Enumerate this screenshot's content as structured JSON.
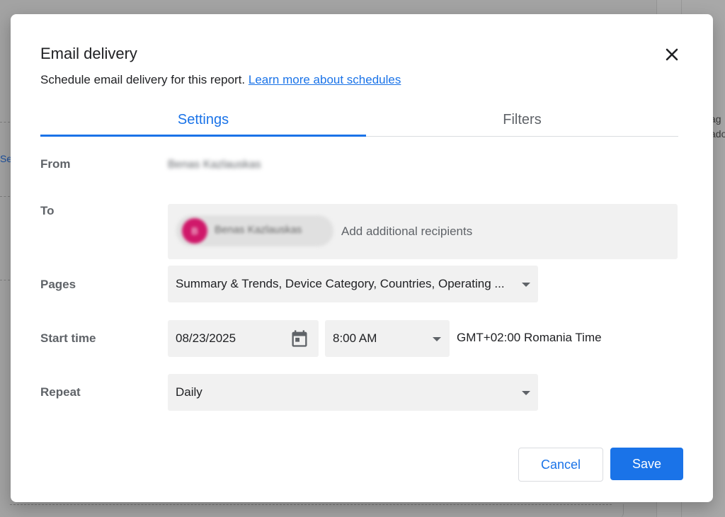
{
  "background": {
    "left_link": "Se",
    "side_text_1": "ag",
    "side_text_2": "ado"
  },
  "dialog": {
    "title": "Email delivery",
    "subtitle": "Schedule email delivery for this report.",
    "learn_more_link": "Learn more about schedules",
    "close_icon": "close-icon"
  },
  "tabs": [
    {
      "label": "Settings",
      "active": true
    },
    {
      "label": "Filters",
      "active": false
    }
  ],
  "form": {
    "from": {
      "label": "From",
      "value": "Benas Kazlauskas"
    },
    "to": {
      "label": "To",
      "recipient_initial": "B",
      "recipient_name": "Benas Kazlauskas",
      "placeholder": "Add additional recipients"
    },
    "pages": {
      "label": "Pages",
      "value": "Summary & Trends, Device Category, Countries, Operating ..."
    },
    "start_time": {
      "label": "Start time",
      "date": "08/23/2025",
      "time": "8:00 AM",
      "timezone": "GMT+02:00 Romania Time"
    },
    "repeat": {
      "label": "Repeat",
      "value": "Daily"
    }
  },
  "actions": {
    "cancel_label": "Cancel",
    "save_label": "Save"
  },
  "colors": {
    "accent": "#1a73e8",
    "avatar": "#d0186a",
    "field_bg": "#f1f1f1"
  }
}
